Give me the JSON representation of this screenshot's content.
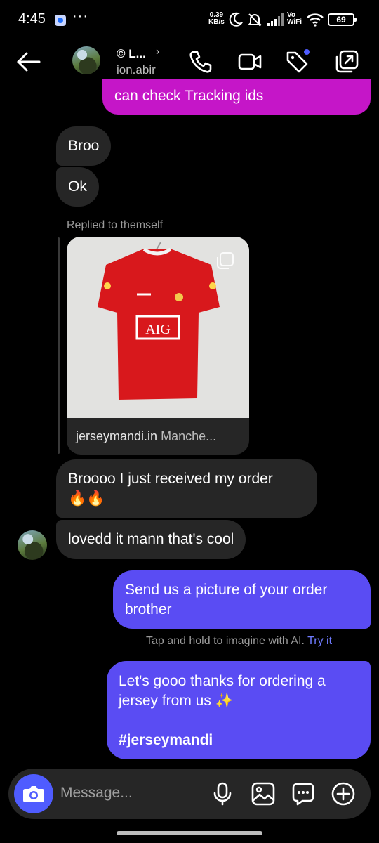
{
  "status_bar": {
    "time": "4:45",
    "more": "···",
    "speed_value": "0.39",
    "speed_unit": "KB/s",
    "vo": "Vo",
    "wifi_label": "WiFi",
    "battery": "69"
  },
  "header": {
    "name": "© L...",
    "username": "ion.abir"
  },
  "chat": {
    "top_partial_message": "can check Tracking ids",
    "msg_broo": "Broo",
    "msg_ok": "Ok",
    "replied_label": "Replied to themself",
    "shared_post": {
      "domain": "jerseymandi.in",
      "title": "Manche...",
      "sponsor_text": "AIG"
    },
    "msg_received_line1": "Broooo I just received my order",
    "msg_received_line2": "🔥🔥",
    "msg_loved": "lovedd it mann that's cool",
    "msg_send_line1": "Send us a picture of your order",
    "msg_send_line2": "brother",
    "ai_hint": "Tap and hold to imagine with AI.",
    "ai_try": "Try it",
    "msg_thanks_line1": "Let's gooo thanks for ordering a",
    "msg_thanks_line2": "jersey from us ✨",
    "msg_thanks_hashtag": "#jerseymandi"
  },
  "composer": {
    "placeholder": "Message..."
  },
  "colors": {
    "outgoing_bubble": "#5a4cf3",
    "incoming_bubble": "#262626",
    "magenta_bubble": "#c516c8",
    "camera_button": "#4f5cff",
    "link_accent": "#6f7bff"
  }
}
